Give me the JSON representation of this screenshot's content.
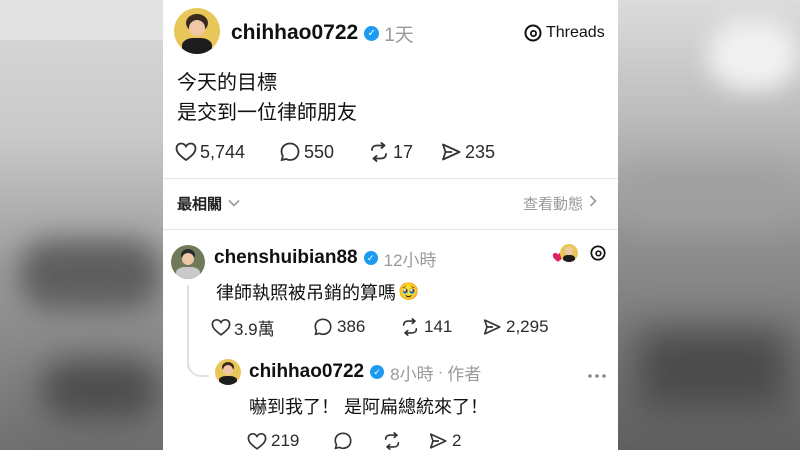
{
  "post": {
    "username": "chihhao0722",
    "time": "1天",
    "brand": "Threads",
    "text_line1": "今天的目標",
    "text_line2": "是交到一位律師朋友",
    "likes": "5,744",
    "replies": "550",
    "reposts": "17",
    "shares": "235"
  },
  "sort": {
    "label": "最相關",
    "view_activity": "查看動態"
  },
  "reply1": {
    "username": "chenshuibian88",
    "time": "12小時",
    "text": "律師執照被吊銷的算嗎",
    "emoji": "🥹",
    "likes": "3.9萬",
    "replies": "386",
    "reposts": "141",
    "shares": "2,295"
  },
  "reply2": {
    "username": "chihhao0722",
    "time": "8小時",
    "author_tag": "作者",
    "separator": "·",
    "text": "嚇到我了！ 是阿扁總統來了！",
    "likes": "219",
    "shares": "2"
  },
  "colors": {
    "verified": "#1d9bf0",
    "heart": "#e0245e",
    "avatar_bg": "#e8c75a"
  }
}
